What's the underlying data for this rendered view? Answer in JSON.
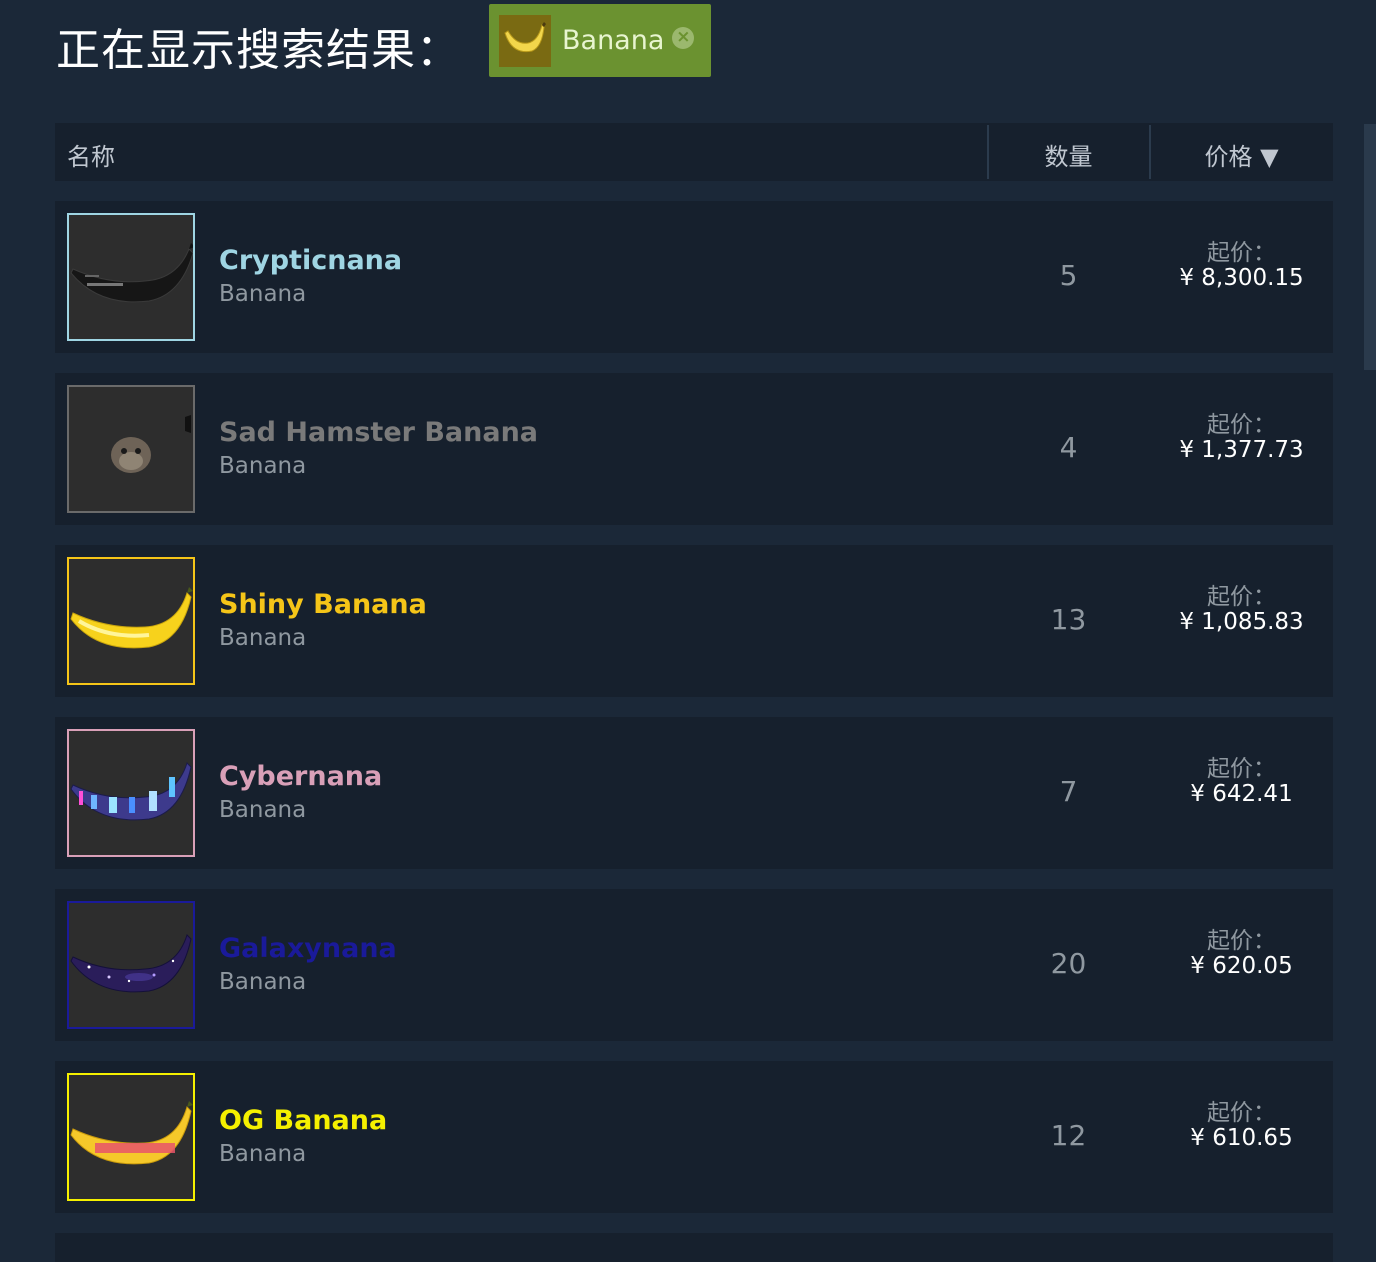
{
  "header": {
    "title": "正在显示搜索结果：",
    "filter_tag": {
      "label": "Banana",
      "remove_icon": "close-icon"
    }
  },
  "table": {
    "columns": {
      "name": "名称",
      "quantity": "数量",
      "price": "价格 ▼"
    },
    "rows": [
      {
        "name": "Crypticnana",
        "game": "Banana",
        "quantity": "5",
        "price_label": "起价：",
        "price": "¥ 8,300.15",
        "name_color": "#9fd5e3",
        "border_color": "#9fd5e3"
      },
      {
        "name": "Sad Hamster Banana",
        "game": "Banana",
        "quantity": "4",
        "price_label": "起价：",
        "price": "¥ 1,377.73",
        "name_color": "#7a7a7a",
        "border_color": "#6a6a6a"
      },
      {
        "name": "Shiny Banana",
        "game": "Banana",
        "quantity": "13",
        "price_label": "起价：",
        "price": "¥ 1,085.83",
        "name_color": "#f5c518",
        "border_color": "#f5c518"
      },
      {
        "name": "Cybernana",
        "game": "Banana",
        "quantity": "7",
        "price_label": "起价：",
        "price": "¥ 642.41",
        "name_color": "#d9a0b8",
        "border_color": "#d9a0b8"
      },
      {
        "name": "Galaxynana",
        "game": "Banana",
        "quantity": "20",
        "price_label": "起价：",
        "price": "¥ 620.05",
        "name_color": "#1a1a9a",
        "border_color": "#1a1a9a"
      },
      {
        "name": "OG Banana",
        "game": "Banana",
        "quantity": "12",
        "price_label": "起价：",
        "price": "¥ 610.65",
        "name_color": "#f5f000",
        "border_color": "#f5f000"
      }
    ]
  }
}
